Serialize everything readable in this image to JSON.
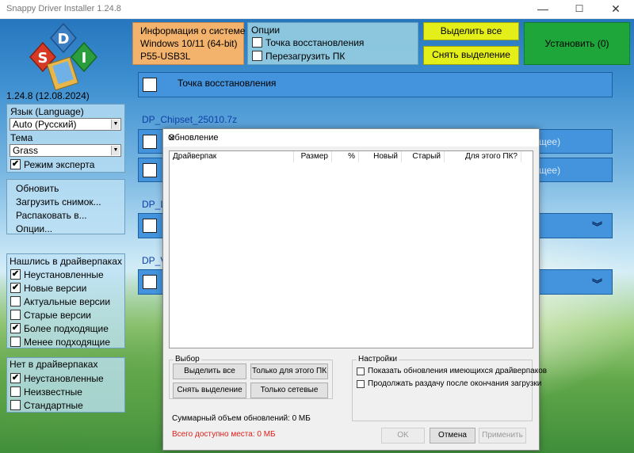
{
  "window": {
    "title": "Snappy Driver Installer 1.24.8",
    "minimize": "—",
    "maximize": "☐",
    "close": "✕"
  },
  "logo": {
    "letters": [
      "D",
      "S",
      "I"
    ]
  },
  "version": "1.24.8 (12.08.2024)",
  "settings": {
    "language_label": "Язык (Language)",
    "language_value": "Auto (Русский)",
    "theme_label": "Тема",
    "theme_value": "Grass",
    "expert_label": "Режим эксперта",
    "expert_checked": "✔"
  },
  "menu": {
    "update": "Обновить",
    "load_snapshot": "Загрузить снимок...",
    "extract": "Распаковать в...",
    "options": "Опции..."
  },
  "found": {
    "header": "Нашлись в драйверпаках",
    "items": [
      {
        "label": "Неустановленные",
        "mark": "✔"
      },
      {
        "label": "Новые версии",
        "mark": "✔"
      },
      {
        "label": "Актуальные версии",
        "mark": ""
      },
      {
        "label": "Старые версии",
        "mark": ""
      },
      {
        "label": "Более подходящие",
        "mark": "✔"
      },
      {
        "label": "Менее подходящие",
        "mark": ""
      }
    ]
  },
  "notfound": {
    "header": "Нет в драйверпаках",
    "items": [
      {
        "label": "Неустановленные",
        "mark": "✔"
      },
      {
        "label": "Неизвестные",
        "mark": ""
      },
      {
        "label": "Стандартные",
        "mark": ""
      }
    ]
  },
  "sysinfo": {
    "title": "Информация о системе",
    "os": "Windows 10/11 (64-bit)",
    "board": "P55-USB3L"
  },
  "options": {
    "title": "Опции",
    "restore": "Точка восстановления",
    "reboot": "Перезагрузить ПК"
  },
  "buttons": {
    "select_all": "Выделить все",
    "deselect": "Снять выделение",
    "install": "Установить (0)"
  },
  "restore_row": "Точка восстановления",
  "packs": {
    "p1": "DP_Chipset_25010.7z",
    "p2": "DP_L",
    "p3": "DP_V"
  },
  "partial": {
    "a": "щее)",
    "b": "щее)"
  },
  "chevron": "︾",
  "dialog": {
    "title": "Обновление",
    "close": "✕",
    "columns": [
      "Драйверпак",
      "Размер",
      "%",
      "Новый",
      "Старый",
      "Для этого ПК?"
    ],
    "selection": {
      "title": "Выбор",
      "select_all": "Выделить все",
      "this_pc": "Только для этого ПК",
      "deselect": "Снять выделение",
      "network": "Только сетевые"
    },
    "settings": {
      "title": "Настройки",
      "show_updates": "Показать обновления имеющихся драйверпаков",
      "continue_seed": "Продолжать раздачу после окончания загрузки"
    },
    "total": "Суммарный объем обновлений: 0 МБ",
    "free": "Всего доступно места: 0 МБ",
    "ok": "OK",
    "cancel": "Отмена",
    "apply": "Применить"
  },
  "colors": {
    "free_text": "#e0201a",
    "install_green": "#1fa63a",
    "yellow": "#e4ee19",
    "sysinfo": "#f3b36c"
  }
}
